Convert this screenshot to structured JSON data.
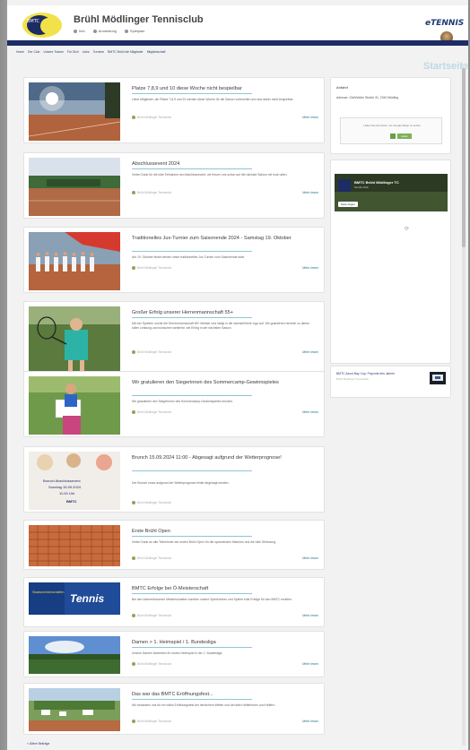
{
  "header": {
    "logo_text": "BMTC",
    "site_title": "Brühl Mödlinger Tennisclub",
    "links": [
      {
        "label": "Info",
        "icon": "info-icon"
      },
      {
        "label": "Anmeldung",
        "icon": "user-icon"
      },
      {
        "label": "Spielplan",
        "icon": "calendar-icon"
      }
    ],
    "brand": "eTENNIS",
    "accent": "#1d2c64"
  },
  "nav": {
    "items": [
      "Home",
      "Der Club",
      "Unsere Trainer",
      "Für Dich",
      "Links",
      "Turniere",
      "BMTC Brühl die Mitglieder",
      "Mitgliedschaft"
    ]
  },
  "page_heading": "Startseite",
  "posts": [
    {
      "title": "Platze 7,8,9 und 10 diese Woche nicht bespielbar",
      "excerpt": "Liebe Mitglieder, die Plätze 7,8,9 und 10 werden diese Woche für die Saison vorbereitet und sind daher nicht bespielbar.",
      "meta": "Brühl Mödlinger Tennisclub",
      "more": "Mehr lesen"
    },
    {
      "title": "Abschlussevent 2024",
      "excerpt": "Vielen Dank für die tolle Teilnahme am Abschlussevent, wir freuen uns schon auf die nächste Saison mit euch allen.",
      "meta": "Brühl Mödlinger Tennisclub",
      "more": "Mehr lesen"
    },
    {
      "title": "Traditionelles Jux-Turnier zum Saisonende 2024 - Samstag 19. Oktober",
      "excerpt": "Am 19. Oktober findet wieder unser traditionelles Jux-Turnier zum Saisonende statt.",
      "meta": "Brühl Mödlinger Tennisclub",
      "more": "Mehr lesen"
    },
    {
      "title": "Großer Erfolg unserer Herrenmannschaft 55+",
      "excerpt": "Mit vier Spielern wurde die Herrenmannschaft 55+ Meister und steigt in die nächsthöhere Liga auf. Wir gratulieren herzlich zu dieser tollen Leistung und wünschen weiterhin viel Erfolg in der nächsten Saison.",
      "meta": "Brühl Mödlinger Tennisclub",
      "more": "Mehr lesen"
    },
    {
      "title": "Wir gratulieren den Siegerinnen des Sommercamp-Gewinnspieles",
      "excerpt": "Wir gratulieren den Siegerinnen des Sommercamp-Gewinnspieles herzlich.",
      "meta": "Brühl Mödlinger Tennisclub",
      "more": "Mehr lesen"
    },
    {
      "title": "Brunch 15.09.2024 11:00 - Abgesagt aufgrund der Wetterprognose!",
      "excerpt": "Der Brunch muss aufgrund der Wetterprognose leider abgesagt werden.",
      "meta": "Brühl Mödlinger Tennisclub",
      "more": "",
      "thumb_text": [
        "Brunch Abschlussevent",
        "Sonntag 15.09.2024",
        "11:00 Uhr",
        "BMTC"
      ]
    },
    {
      "title": "Erste Brühl Open",
      "excerpt": "Vielen Dank an alle Teilnehmer der ersten Brühl Open für die spannenden Matches und die tolle Stimmung.",
      "meta": "Brühl Mödlinger Tennisclub",
      "more": "Mehr lesen"
    },
    {
      "title": "BMTC Erfolge bei Ö-Meisterschaft",
      "excerpt": "Bei den österreichischen Meisterschaften konnten unsere Spielerinnen und Spieler tolle Erfolge für den BMTC erzielen.",
      "meta": "Brühl Mödlinger Tennisclub",
      "more": "Mehr lesen",
      "thumb_text": [
        "Tennis",
        "Staatsmeisterschaften"
      ]
    },
    {
      "title": "Damen > 1. Heimspiel / 1. Bundesliga",
      "excerpt": "Unsere Damen bestreiten ihr erstes Heimspiel in der 1. Bundesliga.",
      "meta": "Brühl Mödlinger Tennisclub",
      "more": "Mehr lesen"
    },
    {
      "title": "Das war das BMTC Eröffnungsfest...",
      "excerpt": "Wir bedanken uns für ein tolles Eröffnungsfest bei herrlichem Wetter und bei allen Helferinnen und Helfern.",
      "meta": "Brühl Mödlinger Tennisclub",
      "more": "Mehr lesen"
    }
  ],
  "sidebar": {
    "address_heading": "Anfahrt",
    "address": "Adresse: Gießhübler Straße 31, 2340 Mödling",
    "map_notice": "Laden Sie die Karte, um Google Maps zu sehen",
    "map_button": "Laden",
    "facebook_title": "BMTC Brühl Mödlinger TC",
    "facebook_sub": "Tennis Club",
    "facebook_button": "Seite folgen",
    "loading_glyph": "⟳",
    "widget_title": "BMTC Ascot Bay Cup: Fixpunkt des Jahres",
    "widget_meta": "Brühl Mödlinger Tennisclub"
  },
  "footer_link": "« Ältere Beiträge"
}
